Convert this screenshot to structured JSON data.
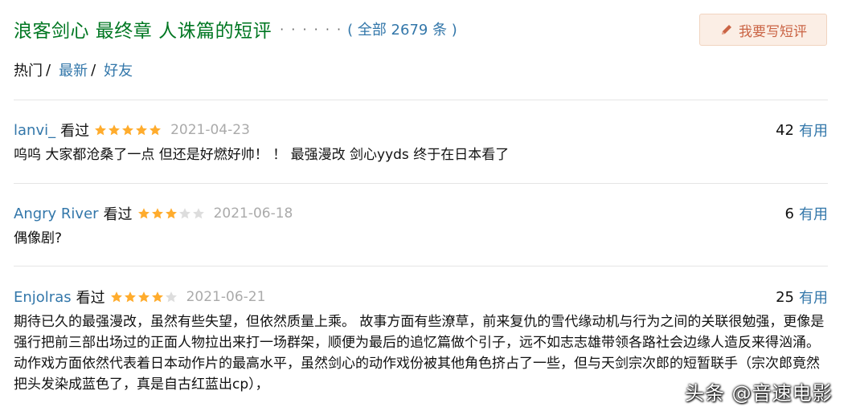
{
  "header": {
    "title": "浪客剑心 最终章 人诛篇的短评",
    "dots": "· · · · · ·",
    "total": "( 全部 2679 条 )"
  },
  "write_button": {
    "label": "我要写短评",
    "icon": "pencil-icon",
    "color": "#ca6445"
  },
  "tabs": [
    {
      "label": "热门",
      "sep": "/"
    },
    {
      "label": "最新",
      "sep": "/"
    },
    {
      "label": "好友"
    }
  ],
  "reviews": [
    {
      "user": "lanvi_",
      "status": "看过",
      "rating": 5,
      "date": "2021-04-23",
      "useful_count": "42",
      "useful_label": "有用",
      "content": "呜呜 大家都沧桑了一点 但还是好燃好帅！ ！ 最强漫改 剑心yyds 终于在日本看了"
    },
    {
      "user": "Angry River",
      "status": "看过",
      "rating": 3,
      "date": "2021-06-18",
      "useful_count": "6",
      "useful_label": "有用",
      "content": "偶像剧?"
    },
    {
      "user": "Enjolras",
      "status": "看过",
      "rating": 4,
      "date": "2021-06-21",
      "useful_count": "25",
      "useful_label": "有用",
      "content": "期待已久的最强漫改，虽然有些失望，但依然质量上乘。 故事方面有些潦草，前来复仇的雪代缘动机与行为之间的关联很勉强，更像是强行把前三部出场过的正面人物拉出来打一场群架，顺便为最后的追忆篇做个引子，远不如志志雄带领各路社会边缘人造反来得汹涌。 动作戏方面依然代表着日本动作片的最高水平，虽然剑心的动作戏份被其他角色挤占了一些，但与天剑宗次郎的短暂联手（宗次郎竟然把头发染成蓝色了，真是自古红蓝出cp），"
    }
  ],
  "watermark": "头条 @音速电影",
  "colors": {
    "title": "#007722",
    "link": "#3377aa",
    "star_on": "#ffac2d",
    "star_off": "#dddddd"
  }
}
